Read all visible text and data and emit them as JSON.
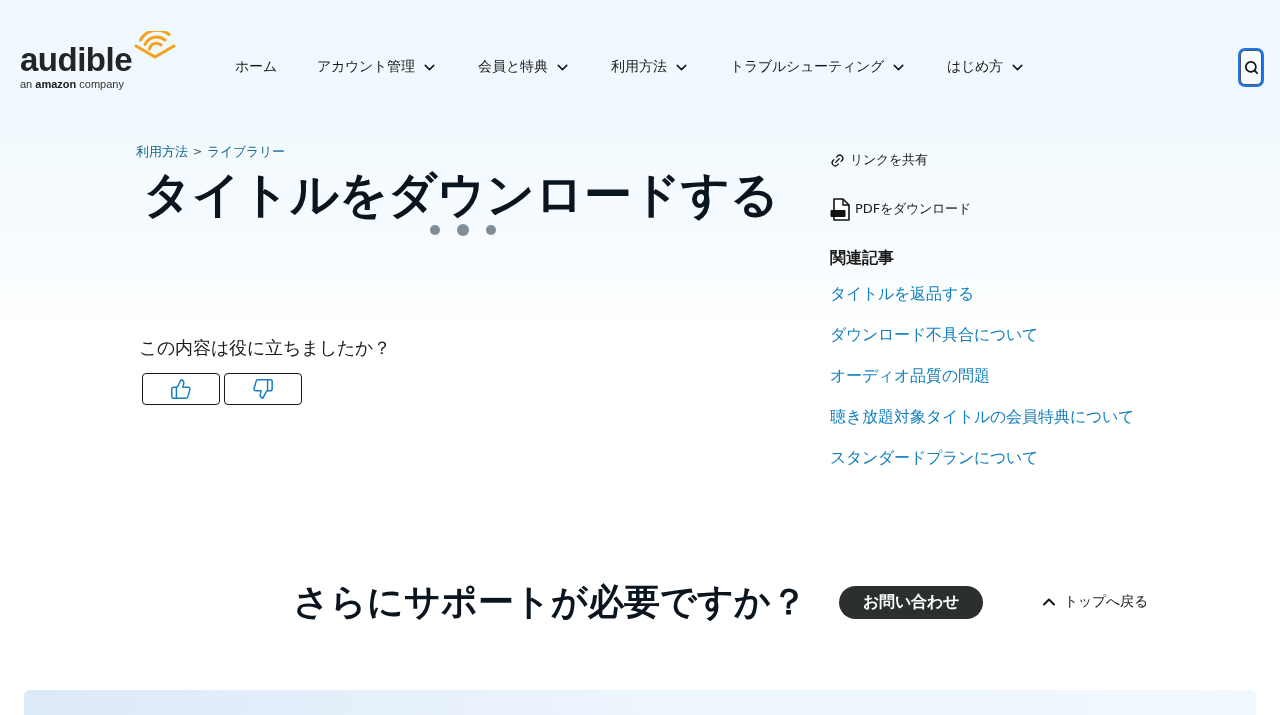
{
  "logo": {
    "wordmark": "audible",
    "tagline": "an **amazon** company"
  },
  "nav": [
    {
      "label": "ホーム",
      "has_menu": false
    },
    {
      "label": "アカウント管理",
      "has_menu": true
    },
    {
      "label": "会員と特典",
      "has_menu": true
    },
    {
      "label": "利用方法",
      "has_menu": true
    },
    {
      "label": "トラブルシューティング",
      "has_menu": true
    },
    {
      "label": "はじめ方",
      "has_menu": true
    }
  ],
  "search_button": {
    "focused": true
  },
  "breadcrumb": {
    "items": [
      {
        "label": "利用方法"
      },
      {
        "label": "ライブラリー"
      }
    ],
    "separator": ">"
  },
  "article": {
    "title": "タイトルをダウンロードする"
  },
  "feedback": {
    "question": "この内容は役に立ちましたか？",
    "buttons": [
      {
        "kind": "thumbs_up"
      },
      {
        "kind": "thumbs_down"
      }
    ]
  },
  "actions": [
    {
      "kind": "share",
      "label": "リンクを共有"
    },
    {
      "kind": "pdf",
      "label": "PDFをダウンロード"
    }
  ],
  "related": {
    "heading": "関連記事",
    "links": [
      "タイトルを返品する",
      "ダウンロード不具合について",
      "オーディオ品質の問題",
      "聴き放題対象タイトルの会員特典について",
      "スタンダードプランについて"
    ]
  },
  "support": {
    "heading": "さらにサポートが必要ですか？",
    "contact_button": "お問い合わせ",
    "back_to_top": "トップへ戻る"
  }
}
